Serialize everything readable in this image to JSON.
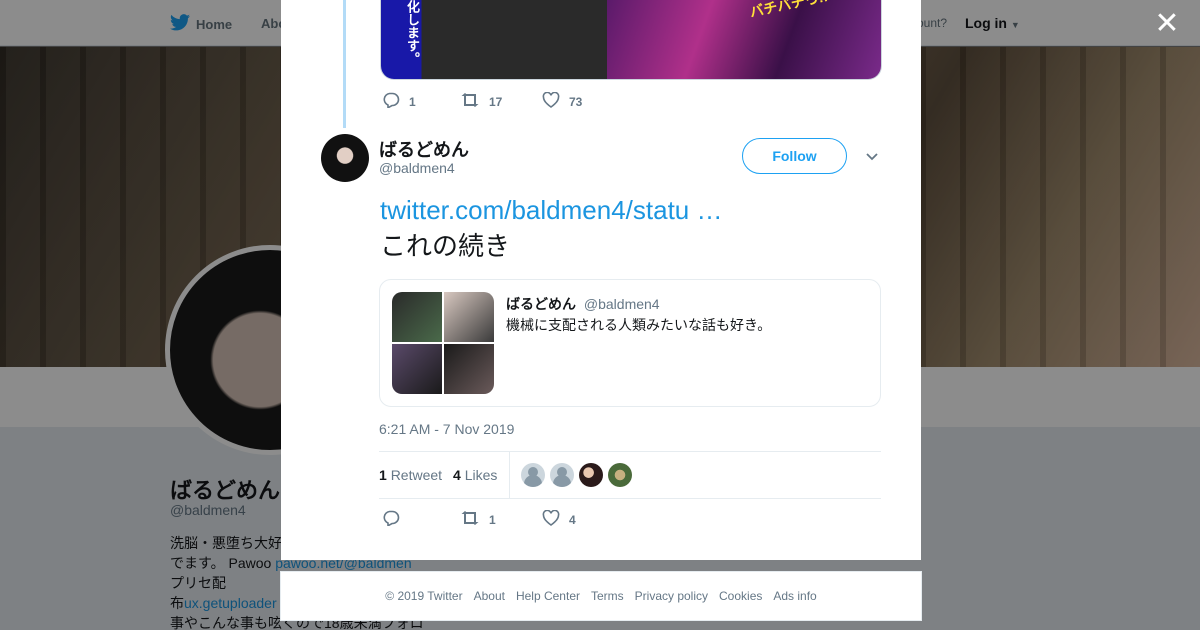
{
  "topbar": {
    "home_label": "Home",
    "about_label": "Abo",
    "account_prompt": "ccount?",
    "login_label": "Log in"
  },
  "profile": {
    "name": "ばるどめん",
    "handle": "@baldmen4",
    "bio_lines": [
      "洗脳・悪堕ち大好",
      "でます。 Pawoo",
      "プリセ配",
      "布",
      "事やこんな事も呟くので18歳未満フォロ"
    ],
    "bio_link_pawoo": "pawoo.net/@baldmen",
    "bio_link_uploader": "ux.getuploader"
  },
  "modal": {
    "prev_tweet": {
      "media_text_left": "化します。",
      "media_text_right": "バチバチっ!!",
      "reply_count": "1",
      "retweet_count": "17",
      "like_count": "73"
    },
    "tweet": {
      "author_name": "ばるどめん",
      "author_handle": "@baldmen4",
      "follow_label": "Follow",
      "link_text": "twitter.com/baldmen4/statu …",
      "body_text": "これの続き",
      "quote": {
        "name": "ばるどめん",
        "handle": "@baldmen4",
        "text": "機械に支配される人類みたいな話も好き。"
      },
      "timestamp": "6:21 AM - 7 Nov 2019",
      "stats": {
        "retweet_num": "1",
        "retweet_label": "Retweet",
        "like_num": "4",
        "like_label": "Likes"
      },
      "actions": {
        "reply_count": "",
        "retweet_count": "1",
        "like_count": "4"
      }
    }
  },
  "footer": {
    "links": [
      "© 2019 Twitter",
      "About",
      "Help Center",
      "Terms",
      "Privacy policy",
      "Cookies",
      "Ads info"
    ]
  },
  "colors": {
    "brand": "#1da1f2",
    "link": "#1b95e0",
    "muted": "#657786",
    "thread_line": "#b3dbf7"
  },
  "icons": [
    "twitter-bird-icon",
    "close-icon",
    "reply-icon",
    "retweet-icon",
    "like-icon",
    "chevron-down-icon"
  ]
}
